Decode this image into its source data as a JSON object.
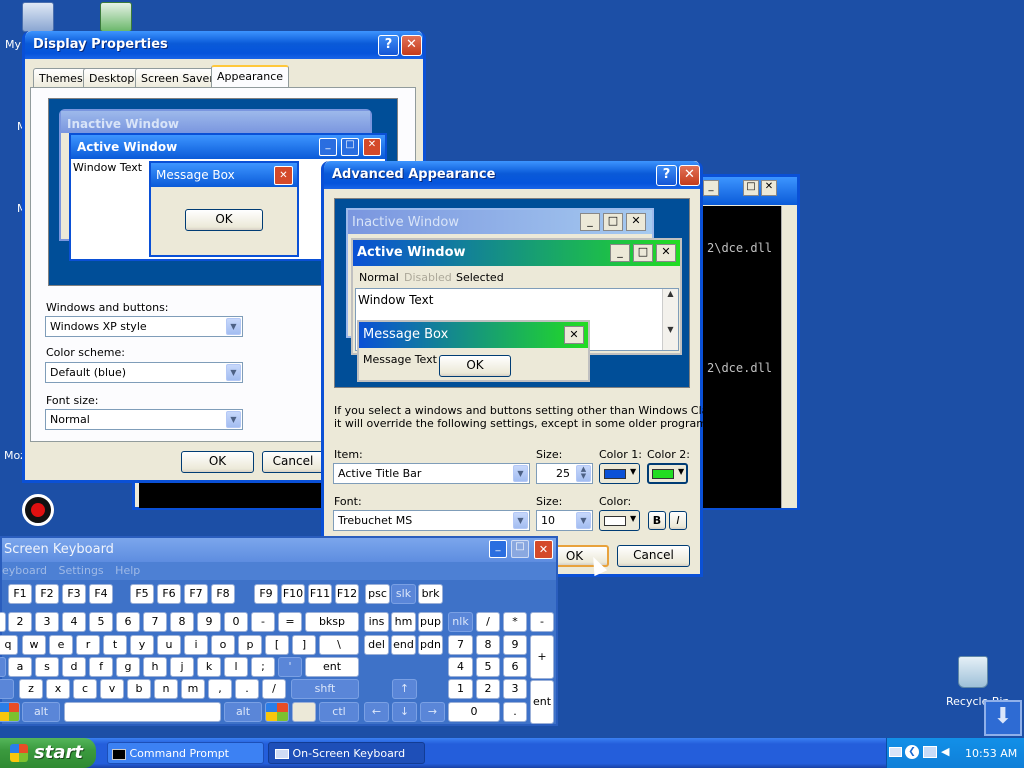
{
  "desktop": {
    "icon_labels": [
      "My",
      "M",
      "M",
      "Moz",
      "Recycle Bin"
    ]
  },
  "display_properties": {
    "title": "Display Properties",
    "help_glyph": "?",
    "close_glyph": "✕",
    "tabs": [
      "Themes",
      "Desktop",
      "Screen Saver",
      "Appearance"
    ],
    "preview": {
      "inactive_title": "Inactive Window",
      "active_title": "Active Window",
      "window_text": "Window Text",
      "msgbox_title": "Message Box",
      "msgbox_ok": "OK"
    },
    "windows_buttons_label": "Windows and buttons:",
    "windows_buttons_value": "Windows XP style",
    "color_scheme_label": "Color scheme:",
    "color_scheme_value": "Default (blue)",
    "font_size_label": "Font size:",
    "font_size_value": "Normal",
    "ok": "OK",
    "cancel": "Cancel"
  },
  "command_prompt": {
    "line1": "2\\dce.dll",
    "line2": "2\\dce.dll"
  },
  "advanced_appearance": {
    "title": "Advanced Appearance",
    "help_glyph": "?",
    "close_glyph": "✕",
    "preview": {
      "inactive_title": "Inactive Window",
      "active_title": "Active Window",
      "menu_normal": "Normal",
      "menu_disabled": "Disabled",
      "menu_selected": "Selected",
      "window_text": "Window Text",
      "msgbox_title": "Message Box",
      "msgbox_text": "Message Text",
      "msgbox_ok": "OK"
    },
    "info_text_line1": "If you select a windows and buttons setting other than Windows Classic,",
    "info_text_line2": "it will override the following settings, except in some older programs.",
    "item_label": "Item:",
    "item_value": "Active Title Bar",
    "size_label": "Size:",
    "size_value": "25",
    "color1_label": "Color 1:",
    "color2_label": "Color 2:",
    "font_label": "Font:",
    "font_value": "Trebuchet MS",
    "font_size_label": "Size:",
    "font_size_value": "10",
    "font_color_label": "Color:",
    "bold": "B",
    "italic": "I",
    "ok": "OK",
    "cancel": "Cancel",
    "colors": {
      "color1": "#0a50d6",
      "color2": "#22dd22",
      "font_color": "#ffffff"
    }
  },
  "osk": {
    "title": "Screen Keyboard",
    "menu": [
      "eyboard",
      "Settings",
      "Help"
    ],
    "row_f": [
      "F1",
      "F2",
      "F3",
      "F4",
      "F5",
      "F6",
      "F7",
      "F8",
      "F9",
      "F10",
      "F11",
      "F12",
      "psc",
      "slk",
      "brk"
    ],
    "row1": [
      "2",
      "3",
      "4",
      "5",
      "6",
      "7",
      "8",
      "9",
      "0",
      "-",
      "=",
      "bksp",
      "ins",
      "hm",
      "pup",
      "nlk",
      "/",
      "*",
      "-"
    ],
    "row2": [
      "q",
      "w",
      "e",
      "r",
      "t",
      "y",
      "u",
      "i",
      "o",
      "p",
      "[",
      "]",
      "\\",
      "del",
      "end",
      "pdn",
      "7",
      "8",
      "9"
    ],
    "row3": [
      "a",
      "s",
      "d",
      "f",
      "g",
      "h",
      "j",
      "k",
      "l",
      ";",
      "'",
      "ent",
      "4",
      "5",
      "6",
      "+"
    ],
    "row4": [
      "z",
      "x",
      "c",
      "v",
      "b",
      "n",
      "m",
      ",",
      ".",
      "/",
      "shft",
      "↑",
      "1",
      "2",
      "3"
    ],
    "row5": [
      "alt",
      "alt",
      "ctl",
      "←",
      "↓",
      "→",
      "0",
      ".",
      "ent"
    ]
  },
  "taskbar": {
    "start": "start",
    "items": [
      "Command Prompt",
      "On-Screen Keyboard"
    ],
    "clock": "10:53 AM"
  }
}
